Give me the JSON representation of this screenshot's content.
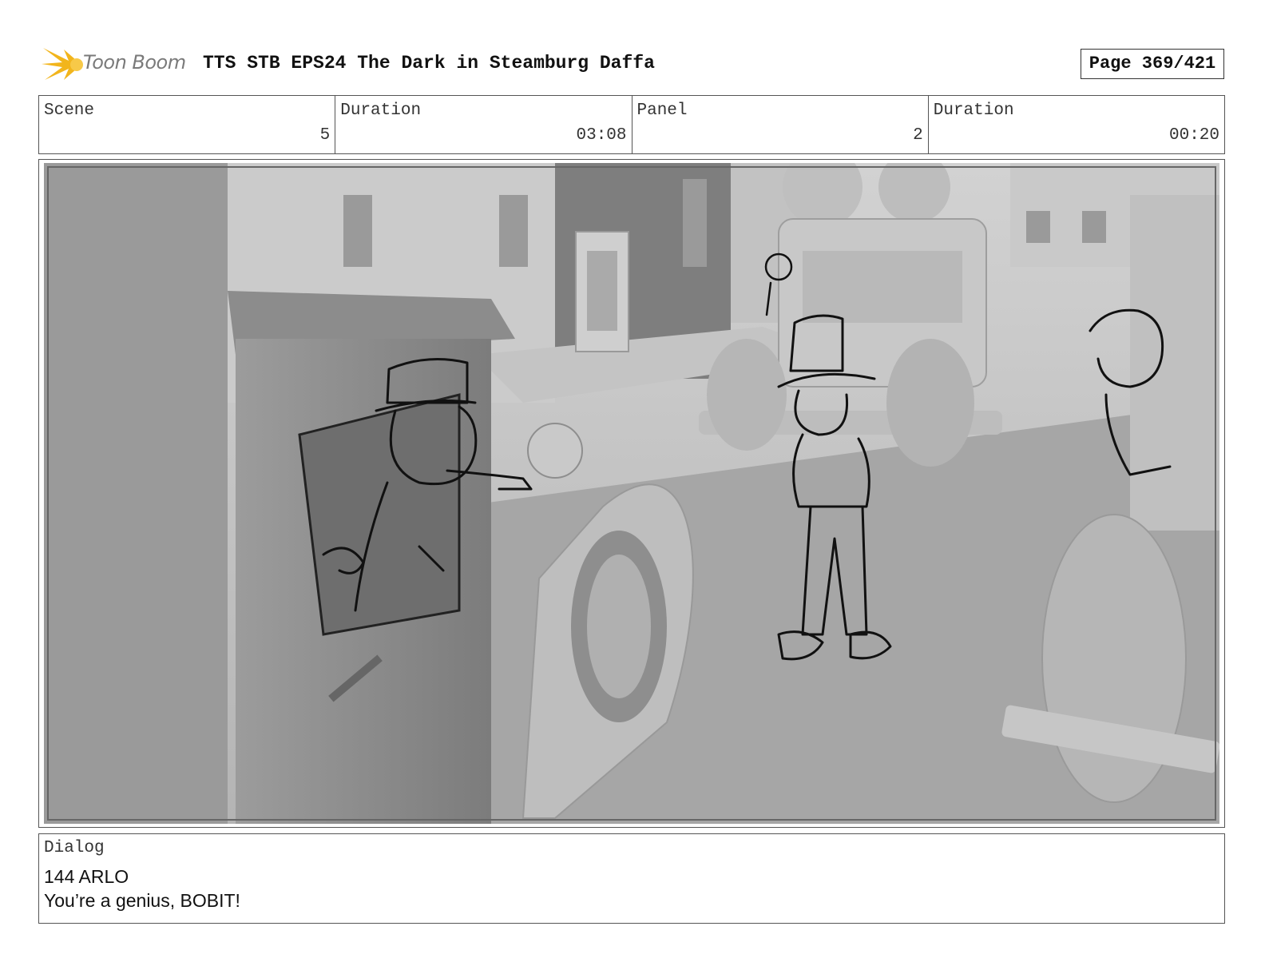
{
  "header": {
    "logo_text": "Toon Boom",
    "title": "TTS STB EPS24 The Dark in Steamburg Daffa",
    "page": "Page 369/421"
  },
  "info": [
    {
      "label": "Scene",
      "value": "5"
    },
    {
      "label": "Duration",
      "value": "03:08"
    },
    {
      "label": "Panel",
      "value": "2"
    },
    {
      "label": "Duration",
      "value": "00:20"
    }
  ],
  "dialog": {
    "label": "Dialog",
    "lines": [
      "144 ARLO",
      "You’re a genius, BOBIT!"
    ]
  },
  "colors": {
    "logo_accent": "#f2b51c",
    "panel_gray": "#a8a8a8"
  }
}
